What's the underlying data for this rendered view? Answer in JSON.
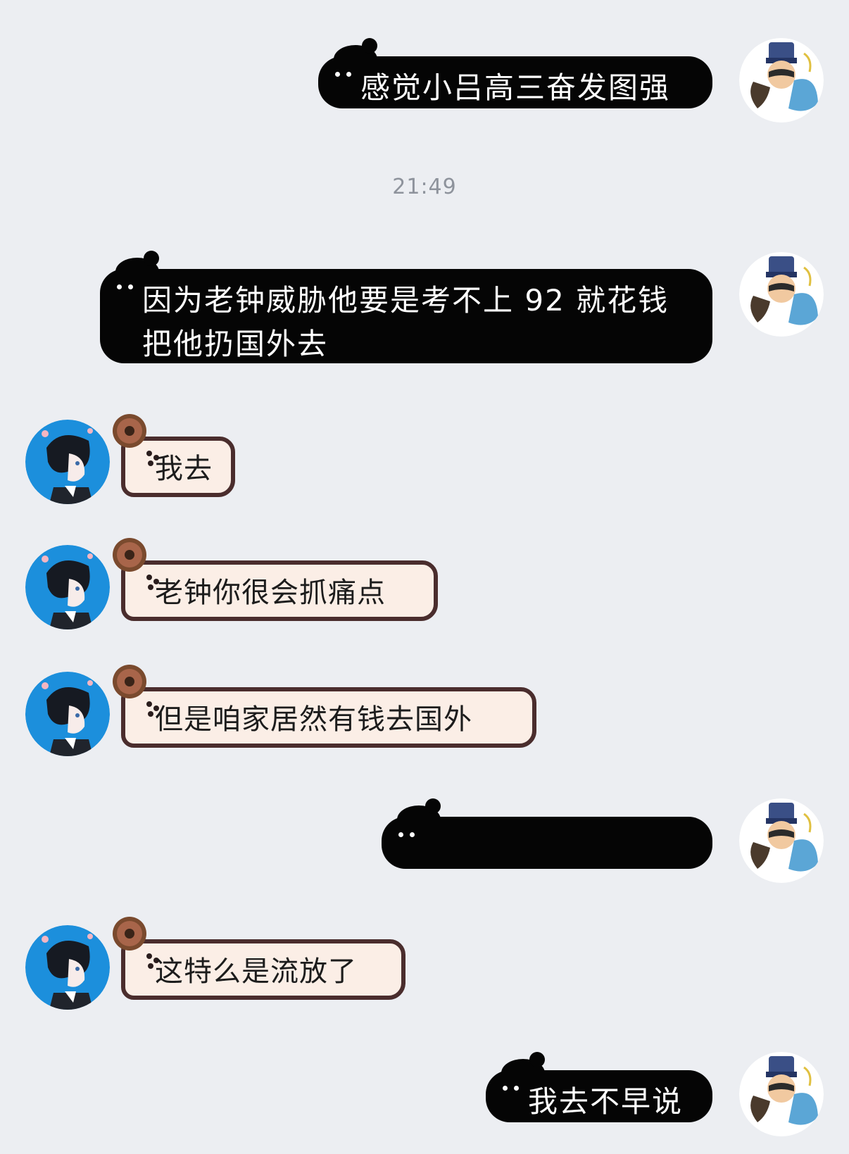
{
  "timestamp": "21:49",
  "messages": [
    {
      "side": "out",
      "text": "感觉小吕高三奋发图强"
    },
    {
      "side": "out",
      "text_line1": "因为老钟威胁他要是考不上 92 就花钱",
      "text_line2": "把他扔国外去"
    },
    {
      "side": "in",
      "text": "我去"
    },
    {
      "side": "in",
      "text": "老钟你很会抓痛点"
    },
    {
      "side": "in",
      "text": "但是咱家居然有钱去国外"
    },
    {
      "side": "out",
      "text": "",
      "redacted": true
    },
    {
      "side": "in",
      "text": "这特么是流放了"
    },
    {
      "side": "out",
      "text": "我去不早说"
    }
  ],
  "avatars": {
    "self": {
      "icon": "anime-character-avatar-blue-hat",
      "bg": "#ffffff"
    },
    "other": {
      "icon": "anime-boy-profile-avatar",
      "bg": "#1c8fdc"
    }
  },
  "colors": {
    "background": "#eceef2",
    "out_bubble": "#050505",
    "in_bubble": "#fbeee6",
    "in_border": "#4a2d2d",
    "timestamp": "#8e939c"
  }
}
